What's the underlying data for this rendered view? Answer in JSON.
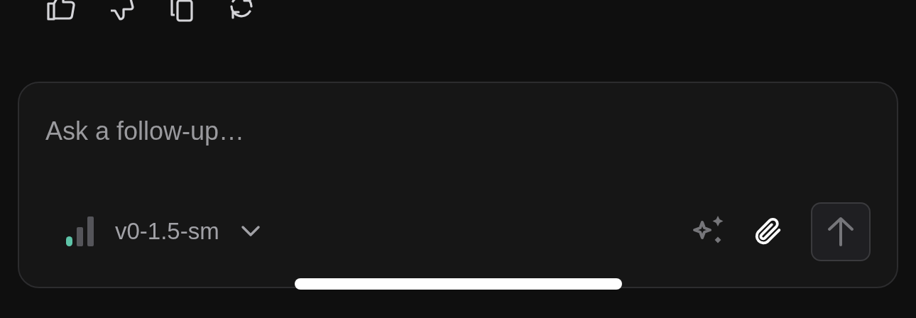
{
  "input": {
    "placeholder": "Ask a follow-up…"
  },
  "model_selector": {
    "label": "v0-1.5-sm"
  }
}
